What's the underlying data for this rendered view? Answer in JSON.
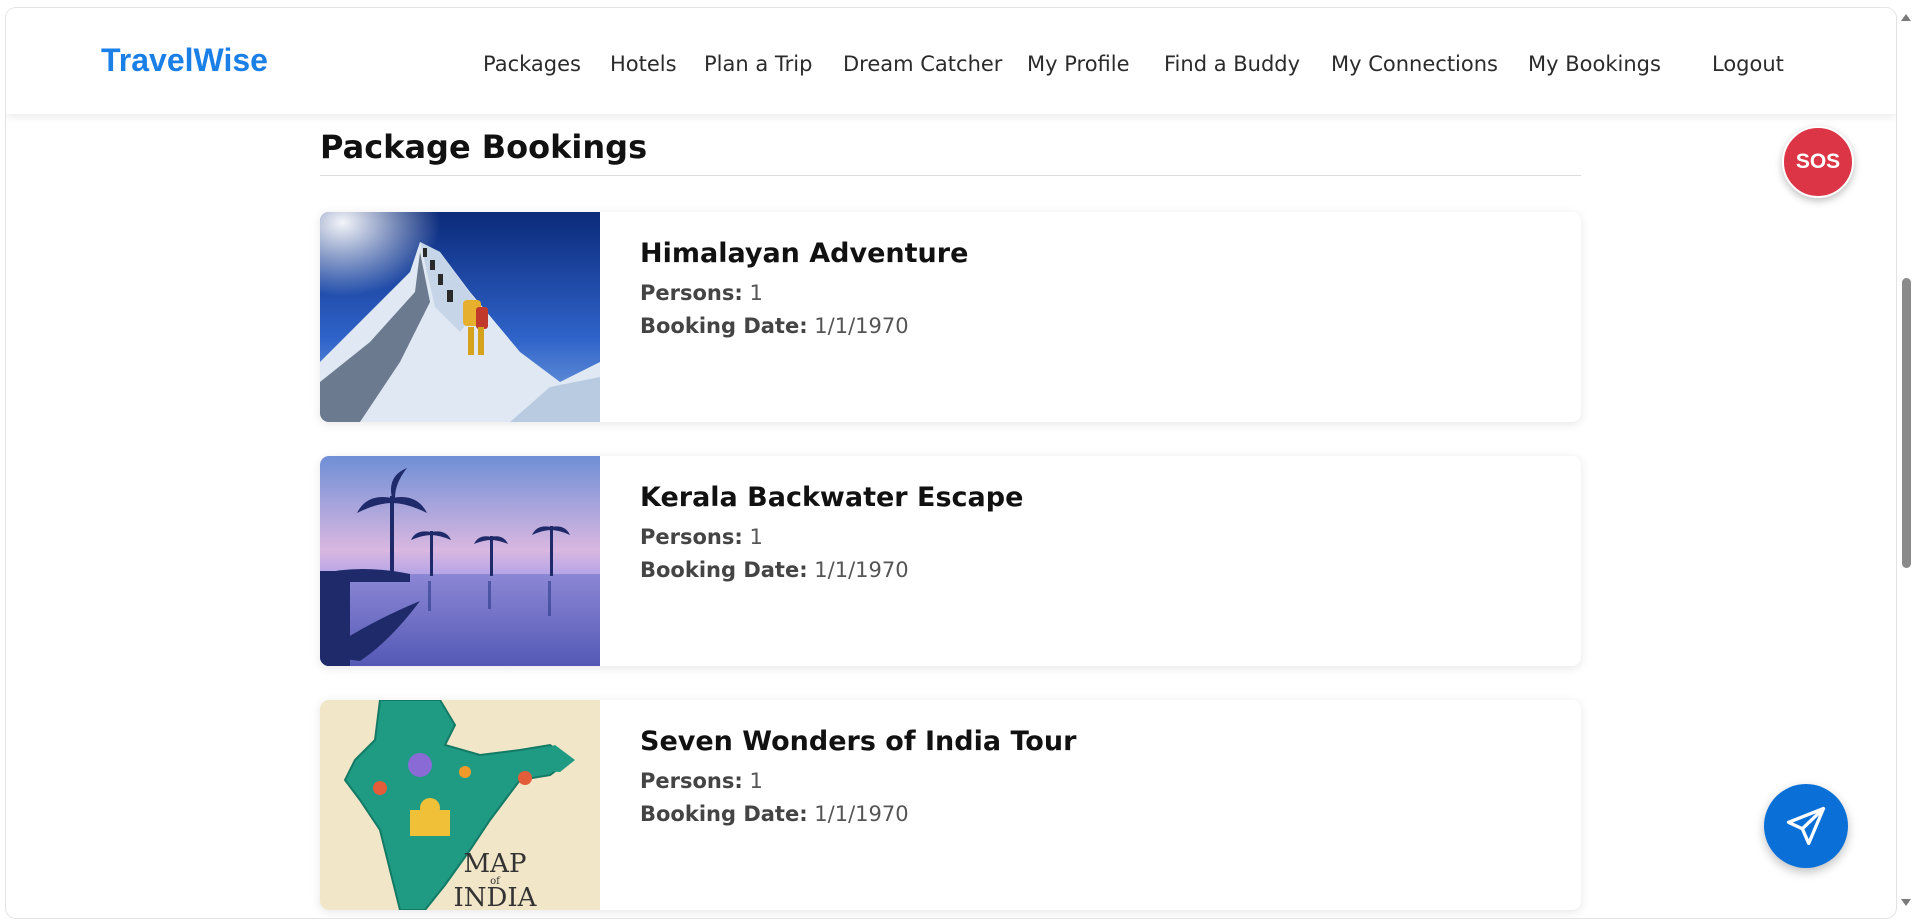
{
  "app": {
    "brand": "TravelWise",
    "brand_color": "#1a7fe6"
  },
  "nav": {
    "items": [
      {
        "label": "Packages"
      },
      {
        "label": "Hotels"
      },
      {
        "label": "Plan a Trip"
      },
      {
        "label": "Dream Catcher"
      },
      {
        "label": "My Profile"
      },
      {
        "label": "Find a Buddy"
      },
      {
        "label": "My Connections"
      },
      {
        "label": "My Bookings"
      },
      {
        "label": "Logout"
      }
    ]
  },
  "page": {
    "title": "Package Bookings"
  },
  "bookings": [
    {
      "title": "Himalayan Adventure",
      "persons_label": "Persons:",
      "persons": "1",
      "date_label": "Booking Date:",
      "date": "1/1/1970",
      "image": "mountain-climbers-photo"
    },
    {
      "title": "Kerala Backwater Escape",
      "persons_label": "Persons:",
      "persons": "1",
      "date_label": "Booking Date:",
      "date": "1/1/1970",
      "image": "backwater-palms-illustration"
    },
    {
      "title": "Seven Wonders of India Tour",
      "persons_label": "Persons:",
      "persons": "1",
      "date_label": "Booking Date:",
      "date": "1/1/1970",
      "image": "map-of-india-illustration",
      "image_text_1": "MAP",
      "image_text_2": "of",
      "image_text_3": "INDIA"
    }
  ],
  "floating": {
    "sos_label": "SOS",
    "sos_color": "#dc3545",
    "send_icon": "paper-plane-icon",
    "send_color": "#0b6fd8"
  }
}
